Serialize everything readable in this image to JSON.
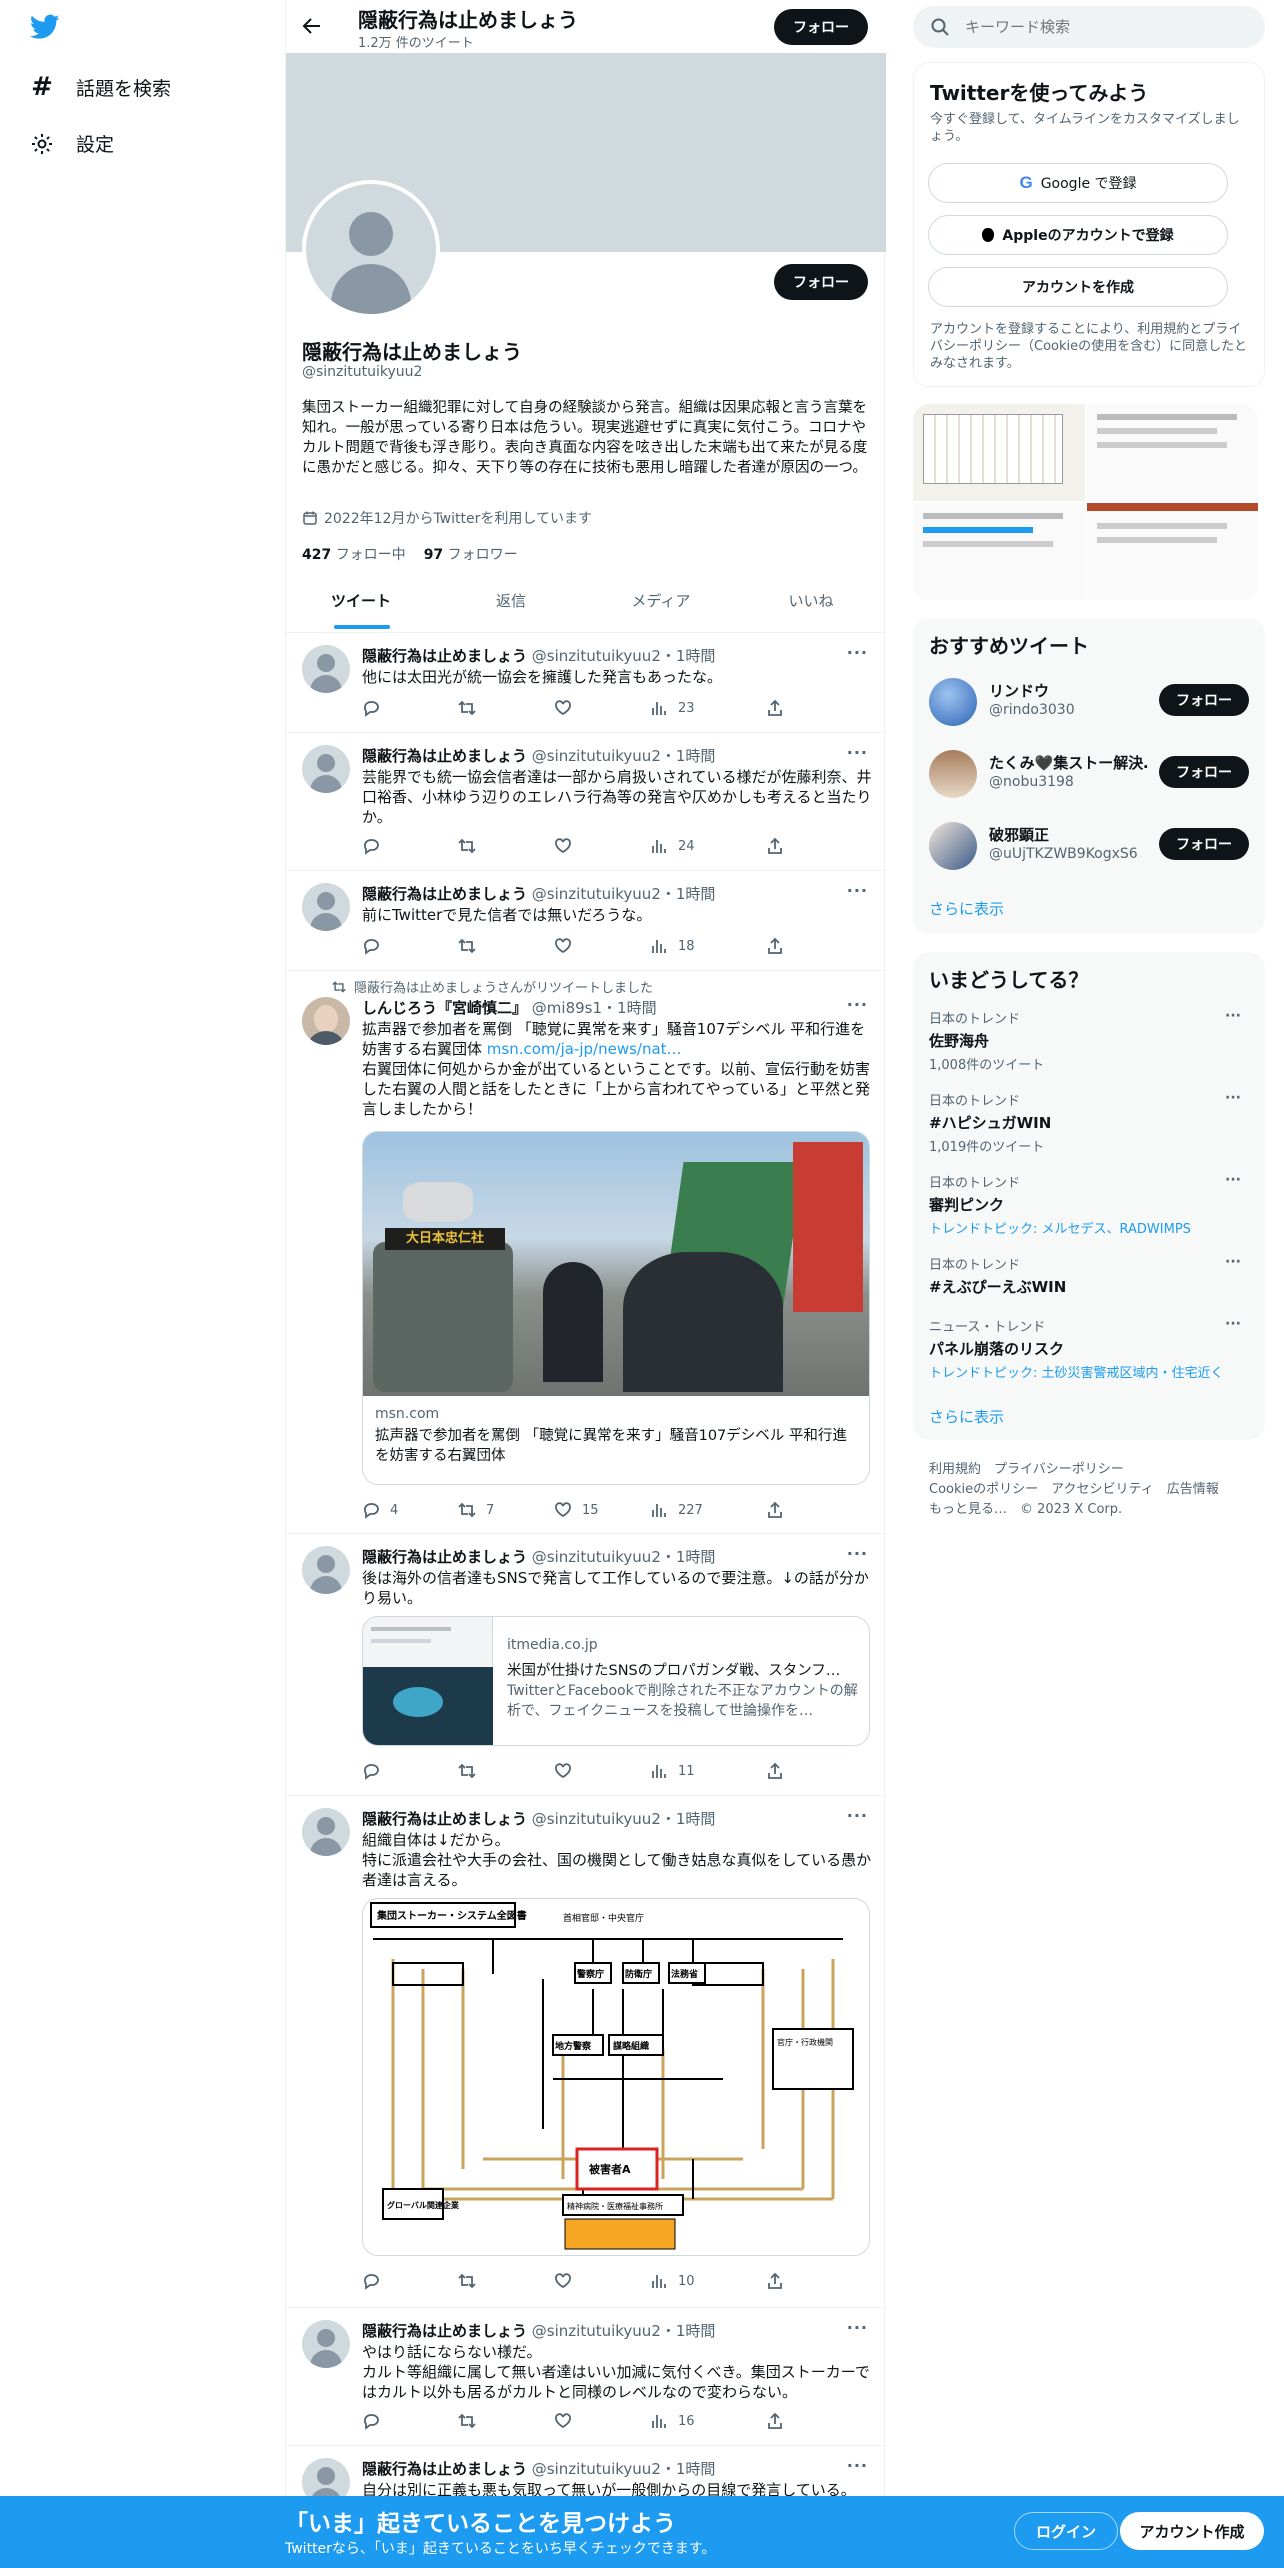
{
  "nav": {
    "explore": "話題を検索",
    "settings": "設定"
  },
  "header": {
    "name": "隠蔽行為は止めましょう",
    "count": "1.2万 件のツイート",
    "follow": "フォロー"
  },
  "profile": {
    "name": "隠蔽行為は止めましょう",
    "handle": "@sinzitutuikyuu2",
    "bio": "集団ストーカー組織犯罪に対して自身の経験談から発言。組織は因果応報と言う言葉を知れ。一般が思っている寄り日本は危うい。現実逃避せずに真実に気付こう。コロナやカルト問題で背後も浮き彫り。表向き真面な内容を呟き出した末端も出て来たが見る度に愚かだと感じる。抑々、天下り等の存在に技術も悪用し暗躍した者達が原因の一つ。",
    "joined": "2022年12月からTwitterを利用しています",
    "following_num": "427",
    "following_label": "フォロー中",
    "followers_num": "97",
    "followers_label": "フォロワー",
    "follow": "フォロー"
  },
  "tabs": [
    "ツイート",
    "返信",
    "メディア",
    "いいね"
  ],
  "tweets": [
    {
      "name": "隠蔽行為は止めましょう",
      "meta": "@sinzitutuikyuu2・1時間",
      "text": "他には太田光が統一協会を擁護した発言もあったな。",
      "views": "23"
    },
    {
      "name": "隠蔽行為は止めましょう",
      "meta": "@sinzitutuikyuu2・1時間",
      "text": "芸能界でも統一協会信者達は一部から肩扱いされている様だが佐藤利奈、井口裕香、小林ゆう辺りのエレハラ行為等の発言や仄めかしも考えると当たりか。",
      "views": "24"
    },
    {
      "name": "隠蔽行為は止めましょう",
      "meta": "@sinzitutuikyuu2・1時間",
      "text": "前にTwitterで見た信者では無いだろうな。",
      "views": "18"
    },
    {
      "retweet": "隠蔽行為は止めましょうさんがリツイートしました",
      "name": "しんじろう『宮崎慎二』",
      "meta": "@mi89s1・1時間",
      "text": "拡声器で参加者を罵倒 「聴覚に異常を来す」騒音107デシベル 平和行進を妨害する右翼団体 ",
      "link": "msn.com/ja-jp/news/nat…",
      "text2": "右翼団体に何処からか金が出ているということです。以前、宣伝行動を妨害した右翼の人間と話をしたときに「上から言われてやっている」と平然と発言しましたから！",
      "card_domain": "msn.com",
      "card_title": "拡声器で参加者を罵倒 「聴覚に異常を来す」騒音107デシベル 平和行進を妨害する右翼団体",
      "banner": "大日本忠仁社",
      "replies": "4",
      "rts": "7",
      "likes": "15",
      "views": "227"
    },
    {
      "name": "隠蔽行為は止めましょう",
      "meta": "@sinzitutuikyuu2・1時間",
      "text": "後は海外の信者達もSNSで発言して工作しているので要注意。↓の話が分かり易い。",
      "card_domain": "itmedia.co.jp",
      "card_title": "米国が仕掛けたSNSのプロパガンダ戦、スタンフ…",
      "card_desc": "TwitterとFacebookで削除された不正なアカウントの解析で、フェイクニュースを投稿して世論操作を…",
      "views": "11"
    },
    {
      "name": "隠蔽行為は止めましょう",
      "meta": "@sinzitutuikyuu2・1時間",
      "text": "組織自体は↓だから。\n特に派遣会社や大手の会社、国の機関として働き姑息な真似をしている愚か者達は言える。",
      "diagram": {
        "title": "集団ストーカー・システム全図書",
        "top": "首相官邸・中央官庁",
        "police": "警察庁",
        "defense": "防衛庁",
        "justice": "法務省",
        "local": "地方警察",
        "org": "謀略組織",
        "victim": "被害者A",
        "global": "グローバル関連企業",
        "medical": "精神病院・医療福祉事務所",
        "gov": "官庁・行政機関"
      },
      "views": "10"
    },
    {
      "name": "隠蔽行為は止めましょう",
      "meta": "@sinzitutuikyuu2・1時間",
      "text": "やはり話にならない様だ。\nカルト等組織に属して無い者達はいい加減に気付くべき。集団ストーカーではカルト以外も居るがカルトと同様のレベルなので変わらない。",
      "views": "16"
    },
    {
      "name": "隠蔽行為は止めましょう",
      "meta": "@sinzitutuikyuu2・1時間",
      "text": "自分は別に正義も悪も気取って無いが一般側からの目線で発言している。"
    }
  ],
  "search": {
    "placeholder": "キーワード検索"
  },
  "signup": {
    "title": "Twitterを使ってみよう",
    "sub": "今すぐ登録して、タイムラインをカスタマイズしましょう。",
    "google": "Google で登録",
    "apple": "Appleのアカウントで登録",
    "create": "アカウントを作成",
    "terms": "アカウントを登録することにより、利用規約とプライバシーポリシー（Cookieの使用を含む）に同意したとみなされます。"
  },
  "recommended": {
    "title": "おすすめツイート",
    "users": [
      {
        "name": "リンドウ",
        "handle": "@rindo3030"
      },
      {
        "name": "たくみ🖤集ストー解決…",
        "handle": "@nobu3198"
      },
      {
        "name": "破邪顕正",
        "handle": "@uUjTKZWB9KogxS6"
      }
    ],
    "follow": "フォロー",
    "more": "さらに表示"
  },
  "trends": {
    "title": "いまどうしてる？",
    "items": [
      {
        "context": "日本のトレンド",
        "name": "佐野海舟",
        "sub": "1,008件のツイート"
      },
      {
        "context": "日本のトレンド",
        "name": "#ハピシュガWIN",
        "sub": "1,019件のツイート"
      },
      {
        "context": "日本のトレンド",
        "name": "審判ピンク",
        "sub": "トレンドトピック: メルセデス、RADWIMPS"
      },
      {
        "context": "日本のトレンド",
        "name": "#えぶぴーえぶWIN",
        "sub": ""
      },
      {
        "context": "ニュース・トレンド",
        "name": "パネル崩落のリスク",
        "sub": "トレンドトピック: 土砂災害警戒区域内・住宅近く"
      }
    ],
    "more": "さらに表示"
  },
  "footer": {
    "line1": "利用規約　プライバシーポリシー",
    "line2": "Cookieのポリシー　アクセシビリティ　広告情報",
    "line3": "もっと見る…　© 2023 X Corp."
  },
  "bottom": {
    "title": "「いま」起きていることを見つけよう",
    "sub": "Twitterなら、「いま」起きていることをいち早くチェックできます。",
    "login": "ログイン",
    "signup": "アカウント作成"
  },
  "colors": {
    "accent": "#1d9bf0",
    "dark": "#0f1419"
  }
}
